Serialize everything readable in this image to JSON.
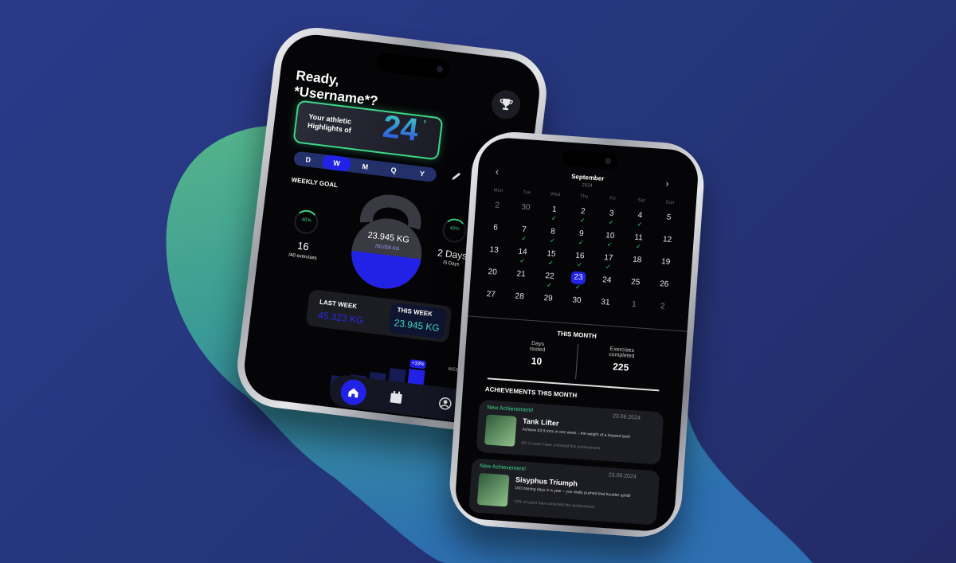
{
  "colors": {
    "accent_blue": "#2222e6",
    "accent_green": "#3fd78a",
    "bg_dark": "#050507"
  },
  "phone1": {
    "greeting_line1": "Ready,",
    "greeting_line2": "*Username*?",
    "trophy_icon": "trophy-icon",
    "highlights": {
      "text_line1": "Your athletic",
      "text_line2": "Highlights of",
      "year": "24",
      "suffix": "'"
    },
    "period_tabs": [
      "D",
      "W",
      "M",
      "Q",
      "Y"
    ],
    "active_tab": "W",
    "edit_icon": "pencil-icon",
    "weekly_goal_label": "WEEKLY GOAL",
    "left_stat": {
      "percent": "40%",
      "value": "16",
      "sub": "/40 exercises"
    },
    "right_stat": {
      "percent": "40%",
      "value": "2 Days",
      "sub": "/5 Days"
    },
    "kettlebell": {
      "value": "23.945 KG",
      "sub": "/50.000 KG",
      "fill": 0.48
    },
    "last_week": {
      "label": "LAST WEEK",
      "value": "45.323 KG"
    },
    "this_week": {
      "label": "THIS WEEK",
      "value": "23.945 KG"
    },
    "bar_badge": "+33%",
    "weekly_goal_line_label": "WEEKLY GOAL",
    "nav": [
      "home-icon",
      "calendar-icon",
      "profile-icon"
    ]
  },
  "phone2": {
    "month": "September",
    "year": "2024",
    "weekdays": [
      "Mon",
      "Tue",
      "Wed",
      "Thu",
      "Fri",
      "Sat",
      "Sun"
    ],
    "weeks": [
      [
        "2",
        "30",
        "1",
        "2",
        "3",
        "4",
        "5"
      ],
      [
        "6",
        "7",
        "8",
        "9",
        "10",
        "11",
        "12"
      ],
      [
        "13",
        "14",
        "15",
        "16",
        "17",
        "18",
        "19"
      ],
      [
        "20",
        "21",
        "22",
        "23",
        "24",
        "25",
        "26"
      ],
      [
        "27",
        "28",
        "29",
        "30",
        "31",
        "1",
        "2"
      ]
    ],
    "selected_day": "23",
    "this_month_label": "THIS MONTH",
    "stats": [
      {
        "label_line1": "Days",
        "label_line2": "rested",
        "value": "10"
      },
      {
        "label_line1": "Exercises",
        "label_line2": "completed",
        "value": "225"
      }
    ],
    "achievements_label": "ACHIEVEMENTS THIS MONTH",
    "achievements": [
      {
        "tag": "New Achievement!",
        "date": "23.09.2024",
        "title": "Tank Lifter",
        "desc": "Achieve 63.9 tons in one week – the weight of a leopard tank!",
        "note": "6% of users have unlocked this achievement"
      },
      {
        "tag": "New Achievement!",
        "date": "23.09.2024",
        "title": "Sisyphus Triumph",
        "desc": "100 training days in a year – you really pushed that boulder uphill!",
        "note": "12% of users have unlocked this achievement"
      }
    ]
  }
}
